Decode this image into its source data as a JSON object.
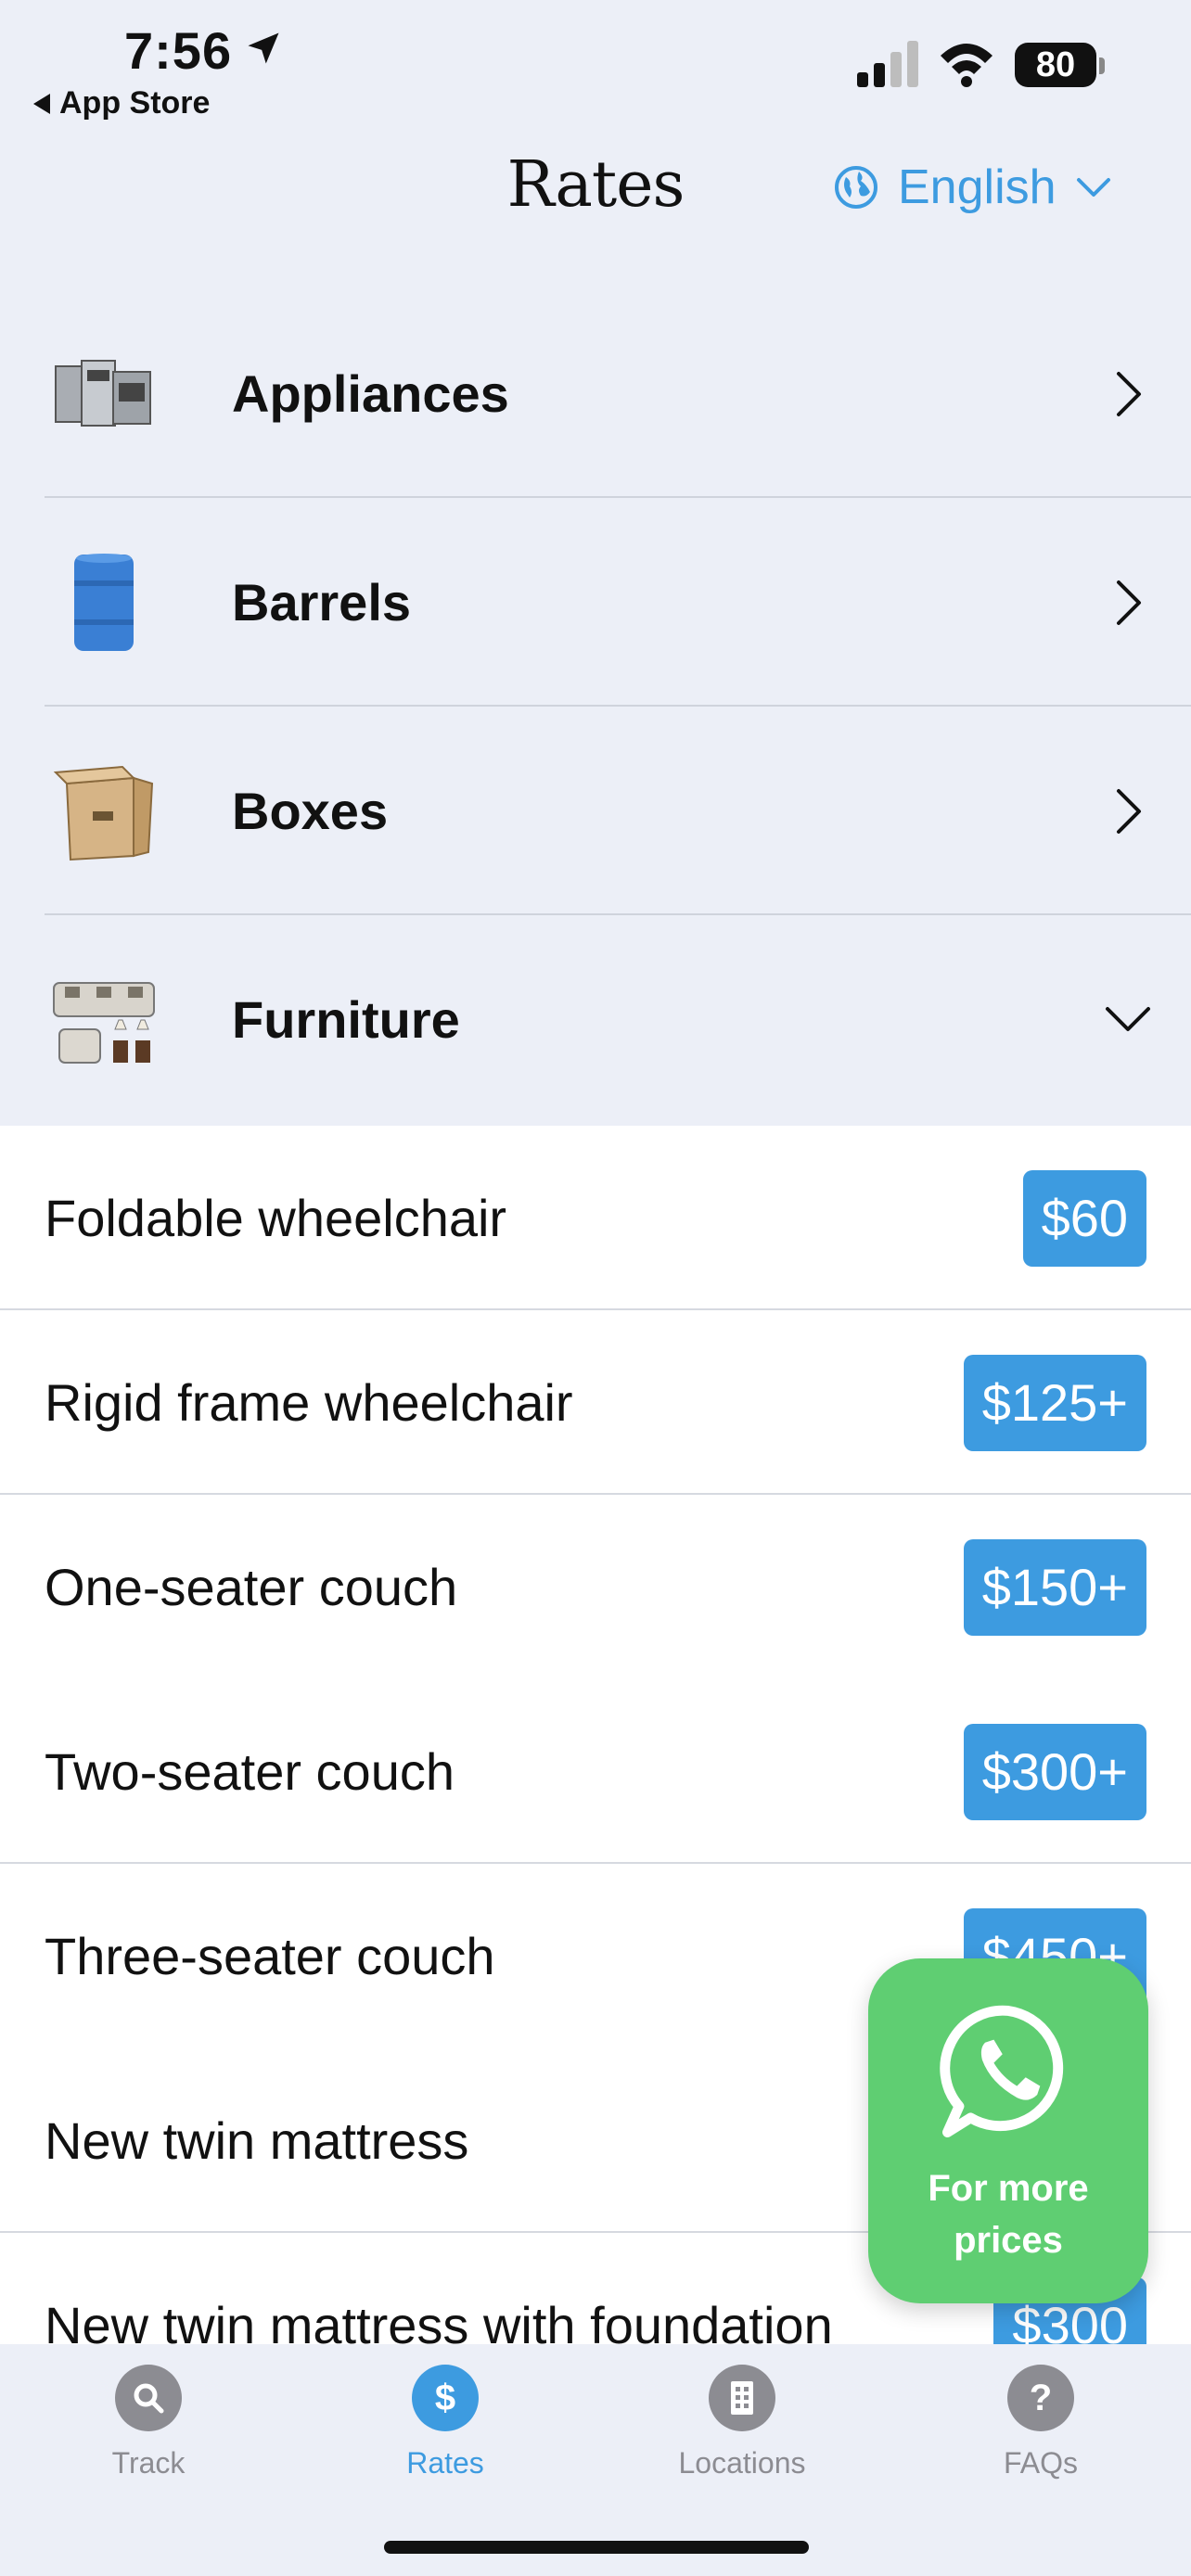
{
  "status_bar": {
    "time": "7:56",
    "back_label": "App Store",
    "battery": "80"
  },
  "header": {
    "title": "Rates",
    "language": "English"
  },
  "categories": [
    {
      "label": "Appliances",
      "icon": "appliances-thumbnail",
      "expanded": false
    },
    {
      "label": "Barrels",
      "icon": "barrel-thumbnail",
      "expanded": false
    },
    {
      "label": "Boxes",
      "icon": "box-thumbnail",
      "expanded": false
    },
    {
      "label": "Furniture",
      "icon": "furniture-thumbnail",
      "expanded": true
    }
  ],
  "furniture_items": [
    {
      "name": "Foldable wheelchair",
      "price": "$60"
    },
    {
      "name": "Rigid frame wheelchair",
      "price": "$125+"
    },
    {
      "name": "One-seater couch",
      "price": "$150+"
    },
    {
      "name": "Two-seater couch",
      "price": "$300+"
    },
    {
      "name": "Three-seater couch",
      "price": "$450+"
    },
    {
      "name": "New twin mattress",
      "price": ""
    },
    {
      "name": "New twin mattress with foundation",
      "price": "$300"
    }
  ],
  "whatsapp_button": {
    "label": "For more prices",
    "icon": "whatsapp-icon",
    "color": "#5fce72"
  },
  "tabs": [
    {
      "label": "Track",
      "icon": "search-icon",
      "active": false
    },
    {
      "label": "Rates",
      "icon": "dollar-icon",
      "active": true
    },
    {
      "label": "Locations",
      "icon": "building-icon",
      "active": false
    },
    {
      "label": "FAQs",
      "icon": "question-icon",
      "active": false
    }
  ],
  "colors": {
    "accent": "#3d9be0",
    "background": "#eceff7",
    "inactive_tab": "#8c8c92"
  }
}
